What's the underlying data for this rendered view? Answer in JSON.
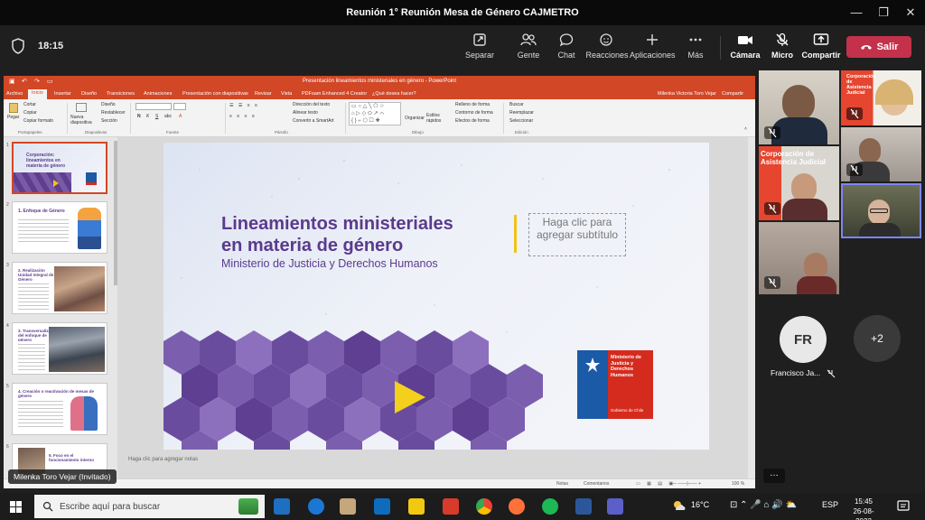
{
  "window": {
    "title": "Reunión 1° Reunión Mesa de Género CAJMETRO"
  },
  "meeting": {
    "elapsed": "18:15",
    "actions": [
      {
        "label": "Separar"
      },
      {
        "label": "Gente"
      },
      {
        "label": "Chat"
      },
      {
        "label": "Reacciones"
      },
      {
        "label": "Aplicaciones"
      },
      {
        "label": "Más"
      },
      {
        "label": "Cámara"
      },
      {
        "label": "Micro"
      },
      {
        "label": "Compartir"
      }
    ],
    "leave_label": "Salir"
  },
  "ppt": {
    "title": "Presentación lineamientos ministeriales en género - PowerPoint",
    "user": "Milenka Victoria Toro Vejar",
    "share": "Compartir",
    "tabs": [
      "Archivo",
      "Inicio",
      "Insertar",
      "Diseño",
      "Transiciones",
      "Animaciones",
      "Presentación con diapositivas",
      "Revisar",
      "Vista",
      "PDFsam Enhanced 4 Creator",
      "¿Qué desea hacer?"
    ],
    "ribbon": {
      "groups": [
        "Portapapeles",
        "Diapositivas",
        "Fuente",
        "Párrafo",
        "Dibujo",
        "Edición"
      ],
      "paste": "Pegar",
      "cut": "Cortar",
      "copy": "Copiar",
      "format_painter": "Copiar formato",
      "new_slide": "Nueva diapositiva",
      "layout": "Diseño",
      "reset": "Restablecer",
      "section": "Sección",
      "text_direction": "Dirección del texto",
      "align_text": "Alinear texto",
      "smartart": "Convertir a SmartArt",
      "arrange": "Organizar",
      "quick_styles": "Estilos rápidos",
      "shape_fill": "Relleno de forma",
      "shape_outline": "Contorno de forma",
      "shape_effects": "Efectos de forma",
      "find": "Buscar",
      "replace": "Reemplazar",
      "select": "Seleccionar"
    },
    "thumbs": [
      {
        "num": "1",
        "text": "Corporación: lineamientos en materia de género"
      },
      {
        "num": "2",
        "text": "1. Enfoque de Género"
      },
      {
        "num": "3",
        "text": "2. Realización Unidad Integral de Género"
      },
      {
        "num": "4",
        "text": "3. Transversalización del enfoque de género"
      },
      {
        "num": "5",
        "text": "4. Creación o reactivación de mesas de género"
      },
      {
        "num": "6",
        "text": "5. Foco en el funcionamiento interno"
      }
    ],
    "slide": {
      "title_line1": "Lineamientos ministeriales",
      "title_line2": "en materia de género",
      "subtitle": "Ministerio de Justicia y Derechos Humanos",
      "placeholder": "Haga clic para agregar subtítulo",
      "logo_text1": "Ministerio de Justicia y Derechos Humanos",
      "logo_text2": "Gobierno de Chile"
    },
    "notes_placeholder": "Haga clic para agregar notas",
    "status": {
      "notes": "Notas",
      "comments": "Comentarios",
      "zoom": "100 %"
    }
  },
  "presenter_chip": "Milenka Toro Vejar (Invitado)",
  "participants": {
    "tile_corp_text1": "Corporación de Asistencia Judicial",
    "tile_corp_text2": "Corporación de Asistencia Judicial",
    "fr_initials": "FR",
    "fr_name": "Francisco Ja...",
    "overflow": "+2"
  },
  "taskbar": {
    "search_placeholder": "Escribe aquí para buscar",
    "weather": "16°C",
    "lang": "ESP",
    "time": "15:45",
    "date": "26-08-2022"
  },
  "colors": {
    "accent_red": "#c4314b",
    "ppt_orange": "#d24726",
    "slide_purple": "#5b3a8d",
    "select_blue": "#7f85f5"
  }
}
